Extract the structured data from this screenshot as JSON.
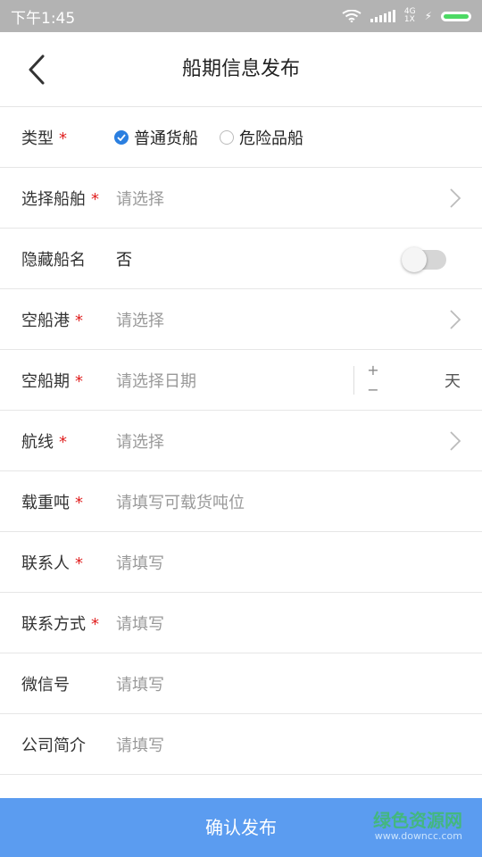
{
  "status_bar": {
    "time": "下午1:45",
    "network": "4G",
    "network_sub": "1X"
  },
  "header": {
    "title": "船期信息发布"
  },
  "form": {
    "type": {
      "label": "类型",
      "required": "*",
      "options": [
        "普通货船",
        "危险品船"
      ],
      "selected": "普通货船"
    },
    "ship": {
      "label": "选择船舶",
      "required": "*",
      "placeholder": "请选择"
    },
    "hide_name": {
      "label": "隐藏船名",
      "value": "否",
      "toggle_on": false
    },
    "port": {
      "label": "空船港",
      "required": "*",
      "placeholder": "请选择"
    },
    "date": {
      "label": "空船期",
      "required": "*",
      "placeholder": "请选择日期",
      "plus": "+",
      "minus": "−",
      "unit": "天"
    },
    "route": {
      "label": "航线",
      "required": "*",
      "placeholder": "请选择"
    },
    "tonnage": {
      "label": "载重吨",
      "required": "*",
      "placeholder": "请填写可载货吨位"
    },
    "contact": {
      "label": "联系人",
      "required": "*",
      "placeholder": "请填写"
    },
    "phone": {
      "label": "联系方式",
      "required": "*",
      "placeholder": "请填写"
    },
    "wechat": {
      "label": "微信号",
      "placeholder": "请填写"
    },
    "company": {
      "label": "公司简介",
      "placeholder": "请填写"
    }
  },
  "actions": {
    "submit_label": "确认发布"
  },
  "watermark": {
    "main": "绿色资源网",
    "sub": "www.downcc.com"
  },
  "colors": {
    "accent": "#2b7fe0",
    "button": "#5b9cf0",
    "required": "#e02020"
  }
}
